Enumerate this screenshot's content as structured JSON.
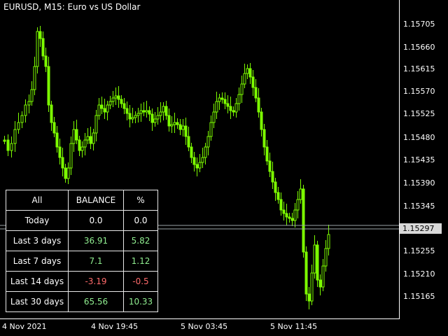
{
  "chart": {
    "title": "EURUSD, M15:  Euro vs US Dollar",
    "price_ticks": [
      "1.15705",
      "1.15660",
      "1.15615",
      "1.15570",
      "1.15525",
      "1.15480",
      "1.15435",
      "1.15390",
      "1.15345",
      "1.15297",
      "1.15255",
      "1.15210",
      "1.15165"
    ],
    "current_price": "1.15297",
    "time_ticks": [
      "4 Nov 2021",
      "4 Nov 19:45",
      "5 Nov 03:45",
      "5 Nov 11:45"
    ],
    "colors": {
      "background": "#000000",
      "candle": "#7CFC00",
      "axis": "#ffffff",
      "price_line": "#9aa3a8"
    }
  },
  "stats_table": {
    "headers": [
      "All",
      "BALANCE",
      "%"
    ],
    "rows": [
      {
        "label": "Today",
        "balance": "0.0",
        "percent": "0.0",
        "tone": "neutral"
      },
      {
        "label": "Last 3 days",
        "balance": "36.91",
        "percent": "5.82",
        "tone": "pos"
      },
      {
        "label": "Last 7 days",
        "balance": "7.1",
        "percent": "1.12",
        "tone": "pos"
      },
      {
        "label": "Last 14 days",
        "balance": "-3.19",
        "percent": "-0.5",
        "tone": "neg"
      },
      {
        "label": "Last 30 days",
        "balance": "65.56",
        "percent": "10.33",
        "tone": "pos"
      }
    ],
    "colors": {
      "pos": "#90ee90",
      "neg": "#ff6b6b",
      "neutral": "#ffffff",
      "border": "#e8e8e8"
    }
  }
}
